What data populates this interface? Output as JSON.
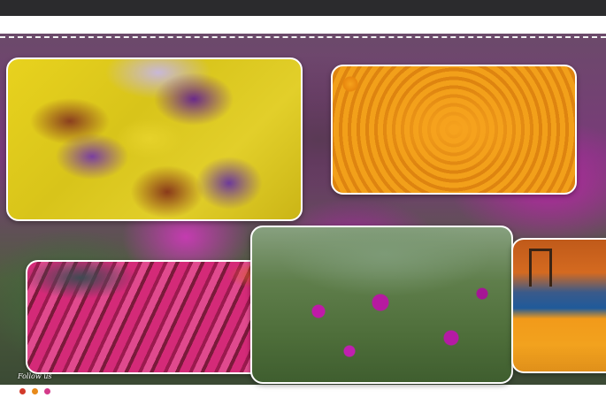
{
  "header": {
    "bar_color": "#2b2b2d"
  },
  "gallery": {
    "photos": [
      {
        "name": "mixed-chrysanthemum-bed-photo"
      },
      {
        "name": "orange-marigold-field-photo"
      },
      {
        "name": "purple-globe-amaranth-photo"
      },
      {
        "name": "pink-rose-garlands-photo"
      },
      {
        "name": "marigold-garlands-stall-photo"
      }
    ]
  },
  "footer": {
    "follow_label": "Follow us",
    "social_icons": [
      "social-icon-red",
      "social-icon-orange",
      "social-icon-pink"
    ]
  },
  "colors": {
    "dash_border": "#f2f2f2",
    "photo_border": "#ffffff"
  }
}
